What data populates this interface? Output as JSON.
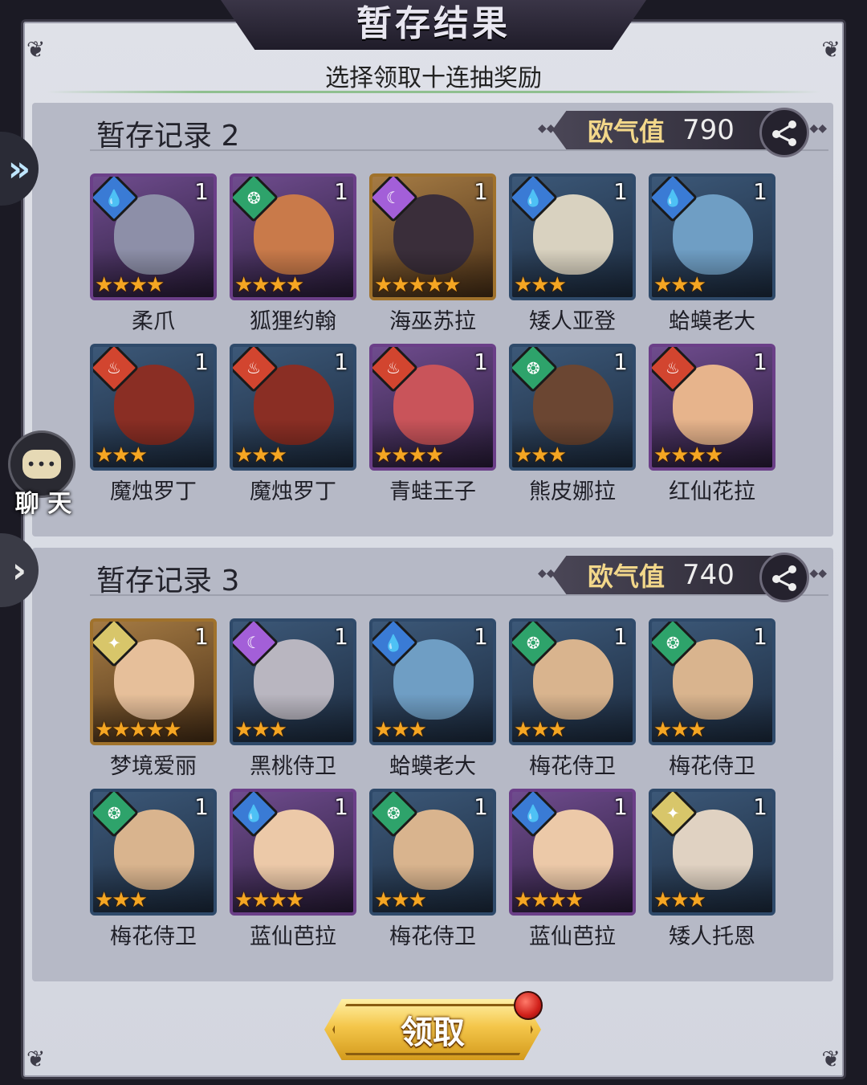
{
  "header": {
    "title": "暂存结果",
    "subtitle": "选择领取十连抽奖励"
  },
  "records": [
    {
      "title": "暂存记录 2",
      "luck_label": "欧气值",
      "luck_value": "790",
      "heroes": [
        {
          "name": "柔爪",
          "element": "water",
          "count": "1",
          "stars": 4,
          "rarity": "purple",
          "skin": "#8d8fa8"
        },
        {
          "name": "狐狸约翰",
          "element": "wind",
          "count": "1",
          "stars": 4,
          "rarity": "purple",
          "skin": "#c97a4a"
        },
        {
          "name": "海巫苏拉",
          "element": "moon",
          "count": "1",
          "stars": 5,
          "rarity": "gold",
          "skin": "#3a2e3a"
        },
        {
          "name": "矮人亚登",
          "element": "water",
          "count": "1",
          "stars": 3,
          "rarity": "blue",
          "skin": "#d9d2c0"
        },
        {
          "name": "蛤蟆老大",
          "element": "water",
          "count": "1",
          "stars": 3,
          "rarity": "blue",
          "skin": "#6f9ec4"
        },
        {
          "name": "魔烛罗丁",
          "element": "fire",
          "count": "1",
          "stars": 3,
          "rarity": "blue",
          "skin": "#8a2e24"
        },
        {
          "name": "魔烛罗丁",
          "element": "fire",
          "count": "1",
          "stars": 3,
          "rarity": "blue",
          "skin": "#8a2e24"
        },
        {
          "name": "青蛙王子",
          "element": "fire",
          "count": "1",
          "stars": 4,
          "rarity": "purple",
          "skin": "#c9545a"
        },
        {
          "name": "熊皮娜拉",
          "element": "wind",
          "count": "1",
          "stars": 3,
          "rarity": "blue",
          "skin": "#6b4632"
        },
        {
          "name": "红仙花拉",
          "element": "fire",
          "count": "1",
          "stars": 4,
          "rarity": "purple",
          "skin": "#e7b48c"
        }
      ]
    },
    {
      "title": "暂存记录 3",
      "luck_label": "欧气值",
      "luck_value": "740",
      "heroes": [
        {
          "name": "梦境爱丽",
          "element": "light",
          "count": "1",
          "stars": 5,
          "rarity": "gold",
          "skin": "#e6bf9a"
        },
        {
          "name": "黑桃侍卫",
          "element": "moon",
          "count": "1",
          "stars": 3,
          "rarity": "blue",
          "skin": "#b9b6c0"
        },
        {
          "name": "蛤蟆老大",
          "element": "water",
          "count": "1",
          "stars": 3,
          "rarity": "blue",
          "skin": "#6f9ec4"
        },
        {
          "name": "梅花侍卫",
          "element": "wind",
          "count": "1",
          "stars": 3,
          "rarity": "blue",
          "skin": "#d9b48e"
        },
        {
          "name": "梅花侍卫",
          "element": "wind",
          "count": "1",
          "stars": 3,
          "rarity": "blue",
          "skin": "#d9b48e"
        },
        {
          "name": "梅花侍卫",
          "element": "wind",
          "count": "1",
          "stars": 3,
          "rarity": "blue",
          "skin": "#d9b48e"
        },
        {
          "name": "蓝仙芭拉",
          "element": "water",
          "count": "1",
          "stars": 4,
          "rarity": "purple",
          "skin": "#ecc9a8"
        },
        {
          "name": "梅花侍卫",
          "element": "wind",
          "count": "1",
          "stars": 3,
          "rarity": "blue",
          "skin": "#d9b48e"
        },
        {
          "name": "蓝仙芭拉",
          "element": "water",
          "count": "1",
          "stars": 4,
          "rarity": "purple",
          "skin": "#ecc9a8"
        },
        {
          "name": "矮人托恩",
          "element": "light",
          "count": "1",
          "stars": 3,
          "rarity": "blue",
          "skin": "#e0d2c2"
        }
      ]
    }
  ],
  "sidebar": {
    "chat_label": "聊 天"
  },
  "footer": {
    "claim_label": "领取"
  },
  "icons": {
    "water": "water-drop-icon",
    "wind": "wind-swirl-icon",
    "moon": "crescent-moon-icon",
    "fire": "flame-icon",
    "light": "sun-star-icon",
    "share": "share-icon",
    "chat": "chat-bubble-icon",
    "expand": "double-chevron-right-icon",
    "collapse": "chevron-right-icon"
  },
  "colors": {
    "star": "#f5a623",
    "luck_label": "#f2d78a",
    "claim_button": "#f4c64a",
    "notification": "#d0201a"
  }
}
